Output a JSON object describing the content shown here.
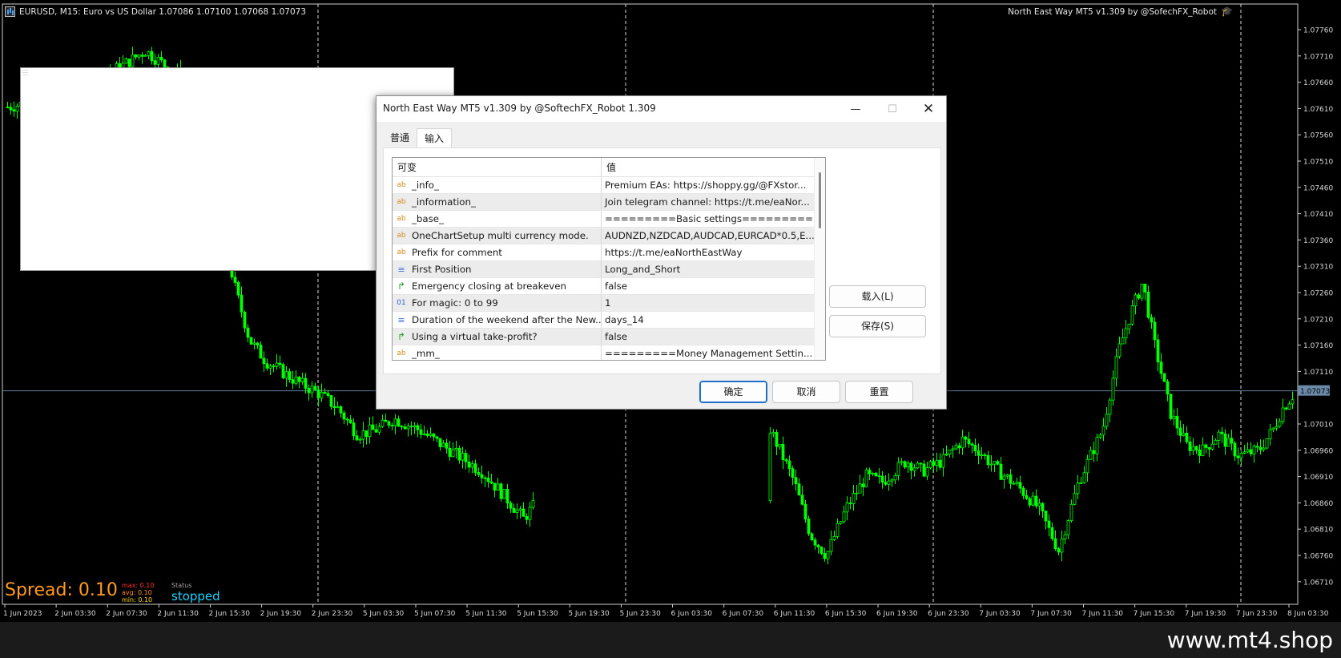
{
  "chart": {
    "symbol_line": "EURUSD, M15:  Euro vs US Dollar  1.07086 1.07100 1.07068 1.07073",
    "ea_title": "North East Way MT5 v1.309 by @SofechFX_Robot",
    "price_labels": [
      "1.07760",
      "1.07710",
      "1.07660",
      "1.07610",
      "1.07560",
      "1.07510",
      "1.07460",
      "1.07410",
      "1.07360",
      "1.07310",
      "1.07260",
      "1.07210",
      "1.07160",
      "1.07110",
      "1.07010",
      "1.06960",
      "1.06910",
      "1.06860",
      "1.06810",
      "1.06760",
      "1.06710"
    ],
    "current_price": "1.07073",
    "time_labels": [
      "1 Jun 2023",
      "2 Jun 03:30",
      "2 Jun 07:30",
      "2 Jun 11:30",
      "2 Jun 15:30",
      "2 Jun 19:30",
      "2 Jun 23:30",
      "5 Jun 03:30",
      "5 Jun 07:30",
      "5 Jun 11:30",
      "5 Jun 15:30",
      "5 Jun 19:30",
      "5 Jun 23:30",
      "6 Jun 03:30",
      "6 Jun 07:30",
      "6 Jun 11:30",
      "6 Jun 15:30",
      "6 Jun 19:30",
      "6 Jun 23:30",
      "7 Jun 03:30",
      "7 Jun 07:30",
      "7 Jun 11:30",
      "7 Jun 15:30",
      "7 Jun 19:30",
      "7 Jun 23:30",
      "8 Jun 03:30"
    ],
    "colors": {
      "candle": "#00ff00",
      "background": "#000000",
      "grid": "#c8c8c8",
      "price_line": "#5f7f9f",
      "price_tag": "#6a8aa8"
    }
  },
  "spread": {
    "label": "Spread: 0.10",
    "max": "max: 0.10",
    "avg": "avg: 0.10",
    "min": "min: 0.10",
    "status_caption": "Status",
    "status_value": "stopped"
  },
  "watermark": "www.mt4.shop",
  "dialog": {
    "title": "North East Way MT5 v1.309 by @SoftechFX_Robot 1.309",
    "tabs": [
      "普通",
      "输入"
    ],
    "active_tab": "输入",
    "columns": [
      "可变",
      "值"
    ],
    "rows": [
      {
        "icon": "ab",
        "name": "_info_",
        "value": "Premium EAs: https://shoppy.gg/@FXstor..."
      },
      {
        "icon": "ab",
        "name": "_information_",
        "value": "Join telegram channel: https://t.me/eaNor..."
      },
      {
        "icon": "ab",
        "name": "_base_",
        "value": "=========Basic settings========="
      },
      {
        "icon": "ab",
        "name": "OneChartSetup multi currency mode.",
        "value": "AUDNZD,NZDCAD,AUDCAD,EURCAD*0.5,E..."
      },
      {
        "icon": "ab",
        "name": "Prefix for comment",
        "value": "https://t.me/eaNorthEastWay"
      },
      {
        "icon": "enum",
        "name": "First Position",
        "value": "Long_and_Short"
      },
      {
        "icon": "bool",
        "name": "Emergency closing at breakeven",
        "value": "false"
      },
      {
        "icon": "num",
        "name": "For magic: 0 to 99",
        "value": "1"
      },
      {
        "icon": "enum",
        "name": "Duration of the weekend after the New...",
        "value": "days_14"
      },
      {
        "icon": "bool",
        "name": "Using a virtual take-profit?",
        "value": "false"
      },
      {
        "icon": "ab",
        "name": "_mm_",
        "value": "=========Money Management Settin..."
      }
    ],
    "icon_glyphs": {
      "ab": "ab",
      "enum": "≡",
      "bool": "↱",
      "num": "01"
    },
    "load_button": "载入(L)",
    "save_button": "保存(S)",
    "ok_button": "确定",
    "cancel_button": "取消",
    "reset_button": "重置"
  }
}
